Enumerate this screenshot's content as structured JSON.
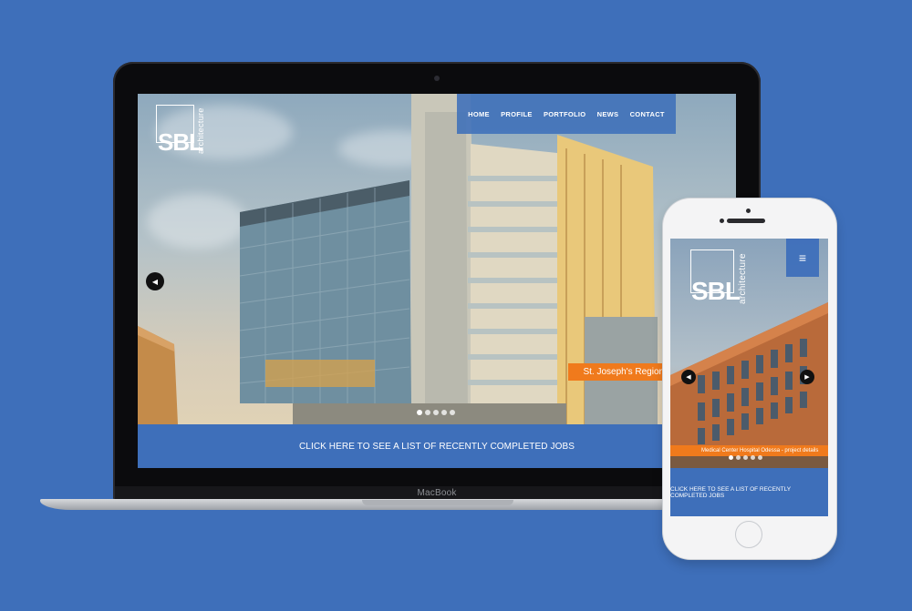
{
  "desktop": {
    "brand": {
      "logo": "SBL",
      "sub": "architecture"
    },
    "nav": [
      {
        "label": "HOME"
      },
      {
        "label": "PROFILE"
      },
      {
        "label": "PORTFOLIO"
      },
      {
        "label": "NEWS"
      },
      {
        "label": "CONTACT"
      }
    ],
    "hero": {
      "caption": "St. Joseph's Regional Medical Cent",
      "slide_count": 5,
      "active_slide": 1
    },
    "cta": "CLICK HERE TO SEE A LIST OF RECENTLY COMPLETED JOBS",
    "device_label": "MacBook"
  },
  "mobile": {
    "brand": {
      "logo": "SBL",
      "sub": "architecture"
    },
    "hero": {
      "caption": "Medical Center Hospital Odessa - project details",
      "slide_count": 5,
      "active_slide": 1
    },
    "cta": "CLICK HERE TO SEE A LIST OF RECENTLY COMPLETED JOBS"
  },
  "colors": {
    "background": "#3e6fba",
    "accent": "#f07a1c",
    "brand": "#3e6fba"
  },
  "icons": [
    "chevron-left-icon",
    "chevron-right-icon",
    "hamburger-menu-icon"
  ]
}
